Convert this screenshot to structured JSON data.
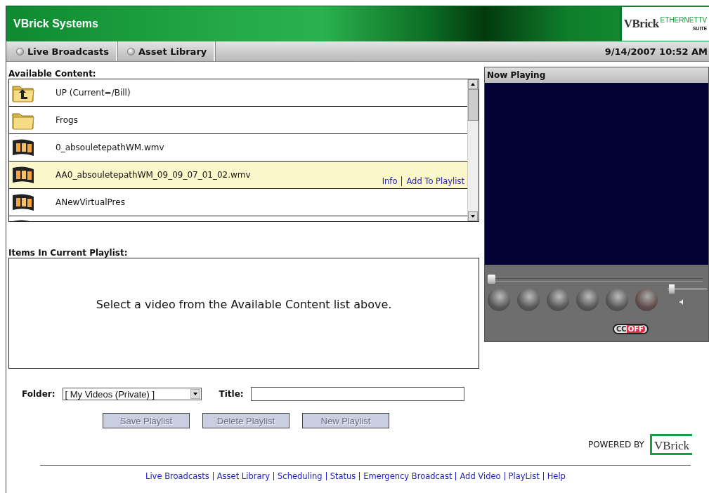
{
  "header": {
    "title": "VBrick Systems",
    "logo": {
      "brand": "VBrick",
      "product": "ETHERNETTV",
      "edition": "SUITE"
    }
  },
  "tabs": [
    {
      "label": "Live Broadcasts",
      "selected": false
    },
    {
      "label": "Asset Library",
      "selected": false
    }
  ],
  "datetime": "9/14/2007 10:52 AM",
  "available_content": {
    "label": "Available Content:",
    "items": [
      {
        "kind": "folder_up",
        "name": "UP (Current=/Bill)",
        "selected": false
      },
      {
        "kind": "folder",
        "name": "Frogs",
        "selected": false
      },
      {
        "kind": "video",
        "name": "0_absouletepathWM.wmv",
        "selected": false
      },
      {
        "kind": "video",
        "name": "AA0_absouletepathWM_09_09_07_01_02.wmv",
        "selected": true,
        "actions": [
          "Info",
          "Add To Playlist"
        ]
      },
      {
        "kind": "video",
        "name": "ANewVirtualPres",
        "selected": false
      }
    ]
  },
  "playlist": {
    "label": "Items In Current Playlist:",
    "message": "Select a video from the Available Content list above."
  },
  "form": {
    "folder_label": "Folder:",
    "folder_value": "[ My Videos (Private) ]",
    "title_label": "Title:",
    "buttons": [
      {
        "label": "Save Playlist",
        "disabled": true
      },
      {
        "label": "Delete Playlist",
        "disabled": true
      },
      {
        "label": "New Playlist",
        "disabled": true
      }
    ]
  },
  "player": {
    "title": "Now Playing",
    "seek": {
      "level": 0
    },
    "volume": {
      "level": 0.03
    },
    "captions": {
      "label": "CC",
      "state": "OFF",
      "on": false
    }
  },
  "powered_by": {
    "label": "POWERED BY",
    "logo": "VBrick"
  },
  "footer_links": [
    "Live Broadcasts",
    "Asset Library",
    "Scheduling",
    "Status",
    "Emergency Broadcast",
    "Add Video",
    "PlayList",
    "Help"
  ]
}
